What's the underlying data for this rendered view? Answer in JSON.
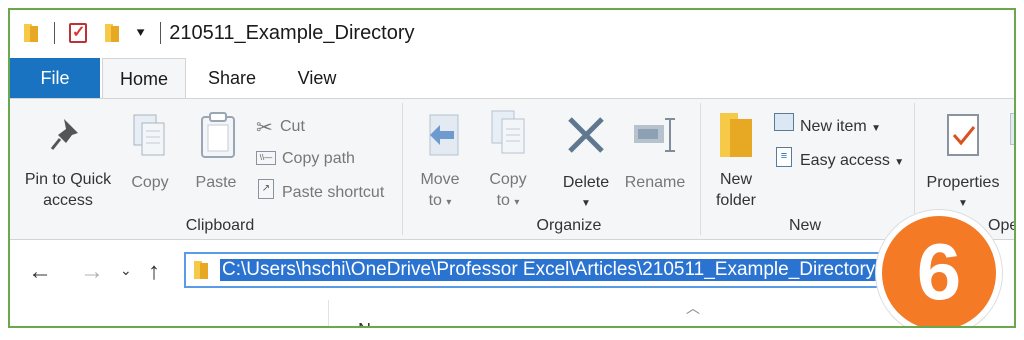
{
  "window": {
    "title": "210511_Example_Directory"
  },
  "tabs": [
    {
      "label": "File"
    },
    {
      "label": "Home"
    },
    {
      "label": "Share"
    },
    {
      "label": "View"
    }
  ],
  "clipboard": {
    "pin_label_1": "Pin to Quick",
    "pin_label_2": "access",
    "copy_label": "Copy",
    "paste_label": "Paste",
    "cut_label": "Cut",
    "copy_path_label": "Copy path",
    "paste_shortcut_label": "Paste shortcut",
    "group_label": "Clipboard"
  },
  "organize": {
    "move_label_1": "Move",
    "move_label_2": "to",
    "copy_to_label_1": "Copy",
    "copy_to_label_2": "to",
    "delete_label": "Delete",
    "rename_label": "Rename",
    "group_label": "Organize"
  },
  "new": {
    "new_folder_label_1": "New",
    "new_folder_label_2": "folder",
    "new_item_label": "New item",
    "easy_access_label": "Easy access",
    "group_label": "New"
  },
  "open": {
    "properties_label": "Properties",
    "group_label_partial": "Ope"
  },
  "address": {
    "path": "C:\\Users\\hschi\\OneDrive\\Professor Excel\\Articles\\210511_Example_Directory"
  },
  "badge": {
    "number": "6"
  },
  "file_list": {
    "name_header": "Name"
  },
  "colors": {
    "accent": "#1a73c0",
    "badge": "#f47a26",
    "frame": "#6aa84f"
  }
}
